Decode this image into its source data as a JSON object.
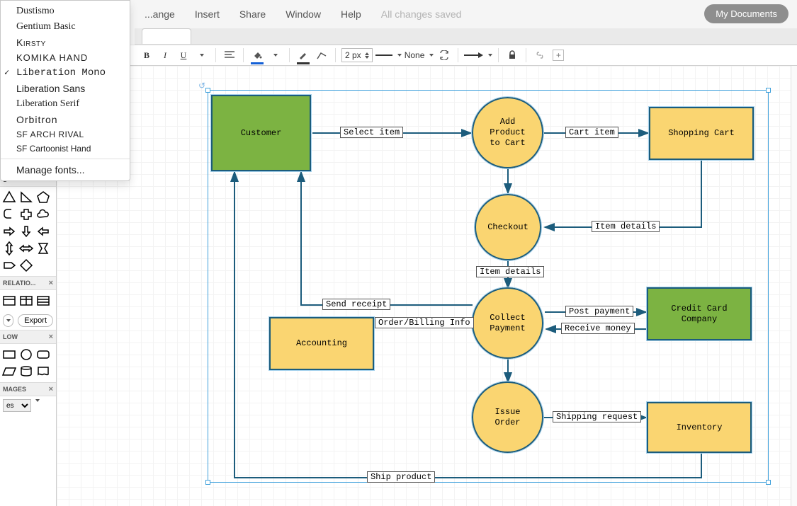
{
  "menubar": {
    "items": [
      "...ange",
      "Insert",
      "Share",
      "Window",
      "Help"
    ],
    "status": "All changes saved",
    "my_docs": "My Documents"
  },
  "font_menu": {
    "items": [
      {
        "label": "Dustismo",
        "cls": "font-dustismo"
      },
      {
        "label": "Gentium Basic",
        "cls": "font-gentium"
      },
      {
        "label": "Kirsty",
        "cls": "font-kirsty"
      },
      {
        "label": "KOMIKA HAND",
        "cls": "font-komika"
      },
      {
        "label": "Liberation Mono",
        "cls": "font-libmono",
        "selected": true
      },
      {
        "label": "Liberation Sans",
        "cls": "font-libsans"
      },
      {
        "label": "Liberation Serif",
        "cls": "font-libserif"
      },
      {
        "label": "Orbitron",
        "cls": "font-orbitron"
      },
      {
        "label": "SF ARCH RIVAL",
        "cls": "font-sfarch"
      },
      {
        "label": "SF Cartoonist Hand",
        "cls": "font-sfcart"
      }
    ],
    "manage": "Manage fonts..."
  },
  "toolbar": {
    "stroke_width": "2 px",
    "dash": "None"
  },
  "sidebar": {
    "shapes_header": "S",
    "export": "Export",
    "relation_header": "RELATIO...",
    "flow_header": "LOW",
    "images_header": "MAGES",
    "images_sel": "es"
  },
  "diagram": {
    "nodes": {
      "customer": "Customer",
      "add_product": "Add\nProduct\nto Cart",
      "shopping_cart": "Shopping Cart",
      "checkout": "Checkout",
      "collect_payment": "Collect\nPayment",
      "credit_card": "Credit Card\nCompany",
      "accounting": "Accounting",
      "issue_order": "Issue\nOrder",
      "inventory": "Inventory"
    },
    "edges": {
      "select_item": "Select item",
      "cart_item": "Cart item",
      "item_details1": "Item details",
      "item_details2": "Item details",
      "send_receipt": "Send receipt",
      "order_billing": "Order/Billing Info",
      "post_payment": "Post payment",
      "receive_money": "Receive money",
      "shipping_request": "Shipping request",
      "ship_product": "Ship product"
    }
  }
}
